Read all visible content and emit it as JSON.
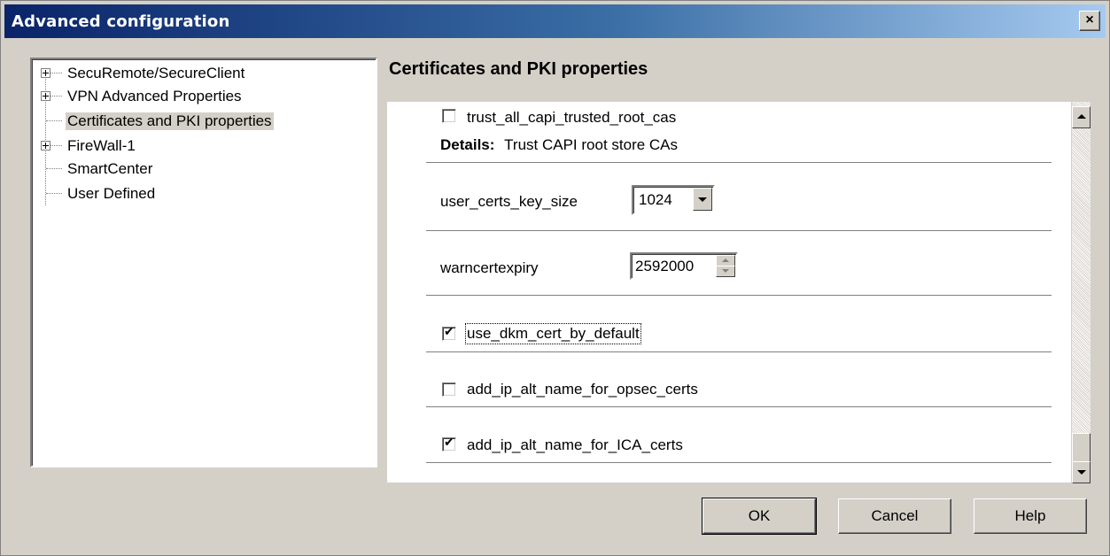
{
  "window": {
    "title": "Advanced configuration",
    "close_glyph": "×"
  },
  "tree": {
    "items": [
      {
        "label": "SecuRemote/SecureClient",
        "expandable": true,
        "selected": false
      },
      {
        "label": "VPN Advanced Properties",
        "expandable": true,
        "selected": false
      },
      {
        "label": "Certificates and PKI properties",
        "expandable": false,
        "selected": true
      },
      {
        "label": "FireWall-1",
        "expandable": true,
        "selected": false
      },
      {
        "label": "SmartCenter",
        "expandable": false,
        "selected": false
      },
      {
        "label": "User Defined",
        "expandable": false,
        "selected": false
      }
    ]
  },
  "section": {
    "title": "Certificates and PKI properties"
  },
  "properties": {
    "trust_capi": {
      "label": "trust_all_capi_trusted_root_cas",
      "checked": false,
      "details_key": "Details:",
      "details_value": "Trust CAPI root store CAs"
    },
    "key_size": {
      "label": "user_certs_key_size",
      "value": "1024"
    },
    "warn_expiry": {
      "label": "warncertexpiry",
      "value": "2592000"
    },
    "use_dkm": {
      "label": "use_dkm_cert_by_default",
      "checked": true
    },
    "opsec_certs": {
      "label": "add_ip_alt_name_for_opsec_certs",
      "checked": false
    },
    "ica_certs": {
      "label": "add_ip_alt_name_for_ICA_certs",
      "checked": true
    }
  },
  "buttons": {
    "ok": "OK",
    "cancel": "Cancel",
    "help": "Help"
  },
  "colors": {
    "title_gradient_start": "#0a246a",
    "title_gradient_end": "#a6caf0",
    "dialog_bg": "#d4d0c8"
  }
}
